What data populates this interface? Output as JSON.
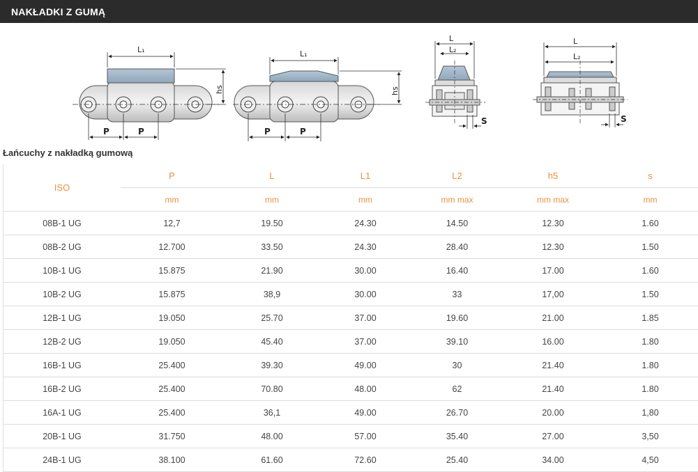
{
  "header": {
    "title": "NAKŁADKI Z GUMĄ"
  },
  "drawing": {
    "labels": {
      "l1": "L₁",
      "l": "L",
      "l2": "L₂",
      "hs": "hs",
      "p": "P",
      "s": "S"
    }
  },
  "section": {
    "subtitle": "Łańcuchy z nakładką gumową"
  },
  "table": {
    "iso_header": "ISO",
    "columns": [
      {
        "name": "P",
        "unit": "mm"
      },
      {
        "name": "L",
        "unit": "mm"
      },
      {
        "name": "L1",
        "unit": "mm"
      },
      {
        "name": "L2",
        "unit": "mm max"
      },
      {
        "name": "h5",
        "unit": "mm max"
      },
      {
        "name": "s",
        "unit": "mm"
      }
    ],
    "rows": [
      [
        "08B-1 UG",
        "12,7",
        "19.50",
        "24.30",
        "14.50",
        "12.30",
        "1.60"
      ],
      [
        "08B-2 UG",
        "12.700",
        "33.50",
        "24.30",
        "28.40",
        "12.30",
        "1.50"
      ],
      [
        "10B-1 UG",
        "15.875",
        "21.90",
        "30.00",
        "16.40",
        "17.00",
        "1.60"
      ],
      [
        "10B-2 UG",
        "15.875",
        "38,9",
        "30.00",
        "33",
        "17,00",
        "1.50"
      ],
      [
        "12B-1 UG",
        "19.050",
        "25.70",
        "37.00",
        "19.60",
        "21.00",
        "1.85"
      ],
      [
        "12B-2 UG",
        "19.050",
        "45.40",
        "37.00",
        "39.10",
        "16.00",
        "1.80"
      ],
      [
        "16B-1 UG",
        "25.400",
        "39.30",
        "49.00",
        "30",
        "21.40",
        "1.80"
      ],
      [
        "16B-2 UG",
        "25.400",
        "70.80",
        "48.00",
        "62",
        "21.40",
        "1.80"
      ],
      [
        "16A-1 UG",
        "25.400",
        "36,1",
        "49.00",
        "26.70",
        "20.00",
        "1,80"
      ],
      [
        "20B-1 UG",
        "31.750",
        "48.00",
        "57.00",
        "35.40",
        "27.00",
        "3,50"
      ],
      [
        "24B-1 UG",
        "38.100",
        "61.60",
        "72.60",
        "25.40",
        "34.00",
        "4,50"
      ]
    ]
  }
}
